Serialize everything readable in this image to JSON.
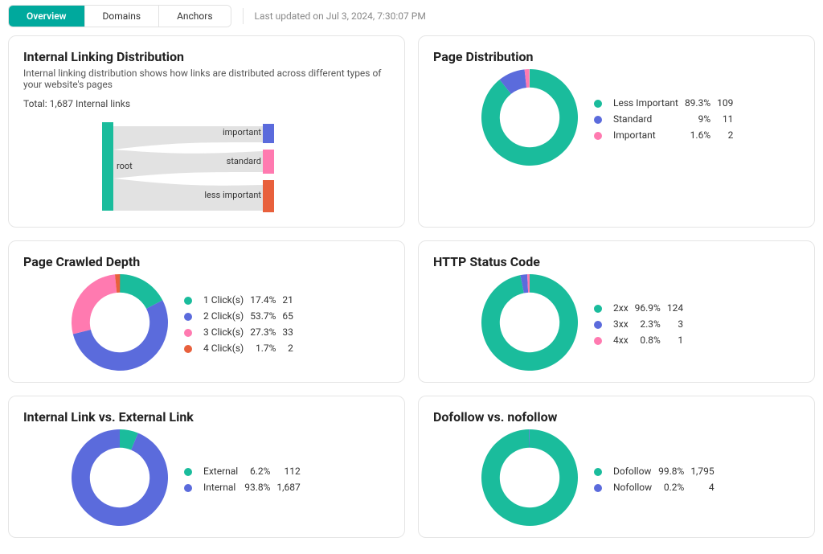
{
  "colors": {
    "teal": "#1abc9c",
    "indigo": "#5b6bdc",
    "pink": "#ff7ab0",
    "red": "#e8603c"
  },
  "tabs": {
    "items": [
      {
        "label": "Overview",
        "active": true
      },
      {
        "label": "Domains",
        "active": false
      },
      {
        "label": "Anchors",
        "active": false
      }
    ]
  },
  "updated": "Last updated on Jul 3, 2024, 7:30:07 PM",
  "sankey_panel": {
    "title": "Internal Linking Distribution",
    "sub": "Internal linking distribution shows how links are distributed across different types of your website's pages",
    "total": "Total: 1,687 Internal links",
    "node_labels": {
      "root": "root",
      "important": "important",
      "standard": "standard",
      "less_important": "less important"
    }
  },
  "page_distribution": {
    "title": "Page Distribution",
    "legend": [
      {
        "label": "Less Important",
        "pct": "89.3%",
        "count": "109",
        "color": "teal"
      },
      {
        "label": "Standard",
        "pct": "9%",
        "count": "11",
        "color": "indigo"
      },
      {
        "label": "Important",
        "pct": "1.6%",
        "count": "2",
        "color": "pink"
      }
    ]
  },
  "page_crawled_depth": {
    "title": "Page Crawled Depth",
    "legend": [
      {
        "label": "1 Click(s)",
        "pct": "17.4%",
        "count": "21",
        "color": "teal"
      },
      {
        "label": "2 Click(s)",
        "pct": "53.7%",
        "count": "65",
        "color": "indigo"
      },
      {
        "label": "3 Click(s)",
        "pct": "27.3%",
        "count": "33",
        "color": "pink"
      },
      {
        "label": "4 Click(s)",
        "pct": "1.7%",
        "count": "2",
        "color": "red"
      }
    ]
  },
  "http_status": {
    "title": "HTTP Status Code",
    "legend": [
      {
        "label": "2xx",
        "pct": "96.9%",
        "count": "124",
        "color": "teal"
      },
      {
        "label": "3xx",
        "pct": "2.3%",
        "count": "3",
        "color": "indigo"
      },
      {
        "label": "4xx",
        "pct": "0.8%",
        "count": "1",
        "color": "pink"
      }
    ]
  },
  "internal_external": {
    "title": "Internal Link vs. External Link",
    "legend": [
      {
        "label": "External",
        "pct": "6.2%",
        "count": "112",
        "color": "teal"
      },
      {
        "label": "Internal",
        "pct": "93.8%",
        "count": "1,687",
        "color": "indigo"
      }
    ]
  },
  "dofollow": {
    "title": "Dofollow vs. nofollow",
    "legend": [
      {
        "label": "Dofollow",
        "pct": "99.8%",
        "count": "1,795",
        "color": "teal"
      },
      {
        "label": "Nofollow",
        "pct": "0.2%",
        "count": "4",
        "color": "indigo"
      }
    ]
  },
  "chart_data": [
    {
      "id": "sankey",
      "type": "sankey",
      "title": "Internal Linking Distribution",
      "nodes": [
        "root",
        "important",
        "standard",
        "less important"
      ],
      "links": [
        {
          "source": "root",
          "target": "important",
          "value": 400
        },
        {
          "source": "root",
          "target": "standard",
          "value": 500
        },
        {
          "source": "root",
          "target": "less important",
          "value": 787
        }
      ],
      "total": 1687
    },
    {
      "id": "page_distribution",
      "type": "donut",
      "title": "Page Distribution",
      "series": [
        {
          "name": "Less Important",
          "value": 109,
          "pct": 89.3
        },
        {
          "name": "Standard",
          "value": 11,
          "pct": 9.0
        },
        {
          "name": "Important",
          "value": 2,
          "pct": 1.6
        }
      ]
    },
    {
      "id": "page_crawled_depth",
      "type": "donut",
      "title": "Page Crawled Depth",
      "series": [
        {
          "name": "1 Click(s)",
          "value": 21,
          "pct": 17.4
        },
        {
          "name": "2 Click(s)",
          "value": 65,
          "pct": 53.7
        },
        {
          "name": "3 Click(s)",
          "value": 33,
          "pct": 27.3
        },
        {
          "name": "4 Click(s)",
          "value": 2,
          "pct": 1.7
        }
      ]
    },
    {
      "id": "http_status",
      "type": "donut",
      "title": "HTTP Status Code",
      "series": [
        {
          "name": "2xx",
          "value": 124,
          "pct": 96.9
        },
        {
          "name": "3xx",
          "value": 3,
          "pct": 2.3
        },
        {
          "name": "4xx",
          "value": 1,
          "pct": 0.8
        }
      ]
    },
    {
      "id": "internal_external",
      "type": "donut",
      "title": "Internal Link vs. External Link",
      "series": [
        {
          "name": "External",
          "value": 112,
          "pct": 6.2
        },
        {
          "name": "Internal",
          "value": 1687,
          "pct": 93.8
        }
      ]
    },
    {
      "id": "dofollow",
      "type": "donut",
      "title": "Dofollow vs. nofollow",
      "series": [
        {
          "name": "Dofollow",
          "value": 1795,
          "pct": 99.8
        },
        {
          "name": "Nofollow",
          "value": 4,
          "pct": 0.2
        }
      ]
    }
  ]
}
